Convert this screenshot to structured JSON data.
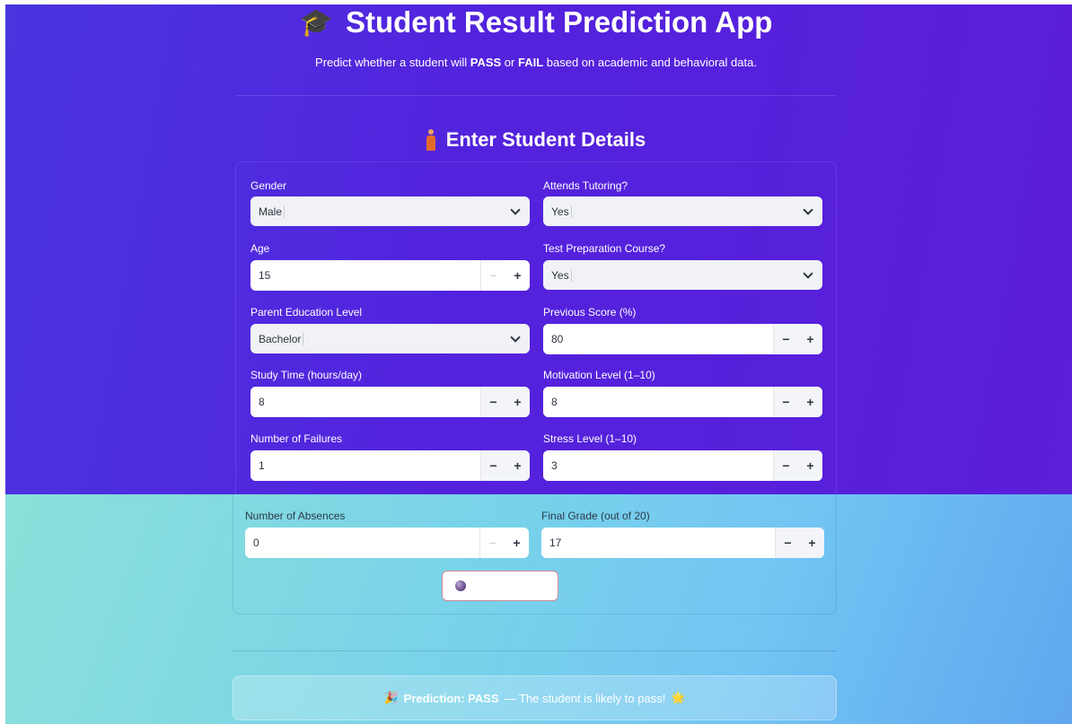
{
  "header": {
    "title": "Student Result Prediction App",
    "cap_icon": "graduation-cap-icon",
    "subtitle_pre": "Predict whether a student will ",
    "subtitle_pass": "PASS",
    "subtitle_or": " or ",
    "subtitle_fail": "FAIL",
    "subtitle_post": " based on academic and behavioral data."
  },
  "section": {
    "title": "Enter Student Details",
    "icon": "person-icon"
  },
  "form": {
    "gender": {
      "label": "Gender",
      "value": "Male"
    },
    "tutoring": {
      "label": "Attends Tutoring?",
      "value": "Yes"
    },
    "age": {
      "label": "Age",
      "value": "15"
    },
    "test_prep": {
      "label": "Test Preparation Course?",
      "value": "Yes"
    },
    "parent_edu": {
      "label": "Parent Education Level",
      "value": "Bachelor"
    },
    "prev_score": {
      "label": "Previous Score (%)",
      "value": "80"
    },
    "study_time": {
      "label": "Study Time (hours/day)",
      "value": "8"
    },
    "motivation": {
      "label": "Motivation Level (1–10)",
      "value": "8"
    },
    "failures": {
      "label": "Number of Failures",
      "value": "1"
    },
    "stress": {
      "label": "Stress Level (1–10)",
      "value": "3"
    },
    "absences": {
      "label": "Number of Absences",
      "value": "0"
    },
    "final_grade": {
      "label": "Final Grade (out of 20)",
      "value": "17"
    },
    "minus": "−",
    "plus": "+"
  },
  "result": {
    "party_emoji": "🎉",
    "label": "Prediction: PASS",
    "message": " — The student is likely to pass! ",
    "star_emoji": "🌟"
  }
}
